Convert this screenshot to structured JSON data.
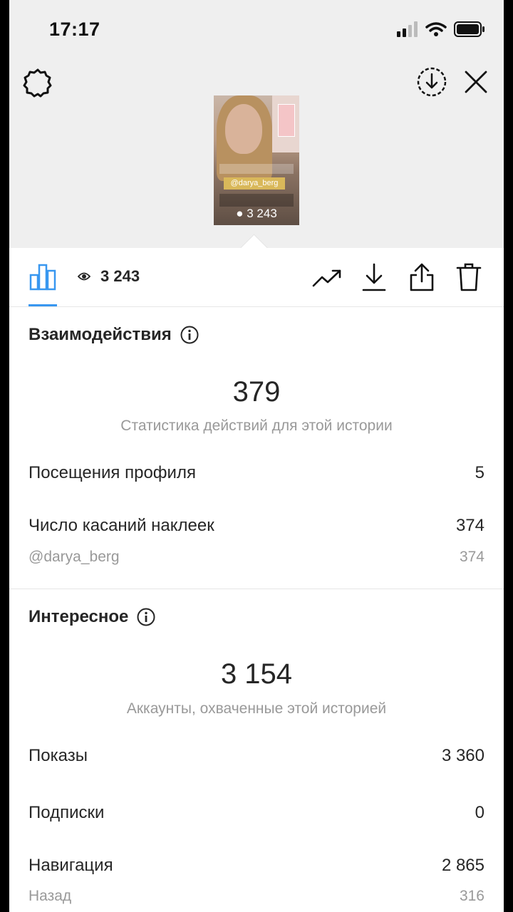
{
  "status": {
    "time": "17:17"
  },
  "thumbnail": {
    "mention": "@darya_berg",
    "views": "3 243"
  },
  "toolbar": {
    "views": "3 243"
  },
  "interactions": {
    "title": "Взаимодействия",
    "total": "379",
    "subtitle": "Статистика действий для этой истории",
    "rows": [
      {
        "label": "Посещения профиля",
        "value": "5"
      },
      {
        "label": "Число касаний наклеек",
        "value": "374"
      }
    ],
    "sub_row": {
      "label": "@darya_berg",
      "value": "374"
    }
  },
  "discovery": {
    "title": "Интересное",
    "total": "3 154",
    "subtitle": "Аккаунты, охваченные этой историей",
    "rows": [
      {
        "label": "Показы",
        "value": "3 360"
      },
      {
        "label": "Подписки",
        "value": "0"
      },
      {
        "label": "Навигация",
        "value": "2 865"
      }
    ],
    "sub_row": {
      "label": "Назад",
      "value": "316"
    }
  }
}
